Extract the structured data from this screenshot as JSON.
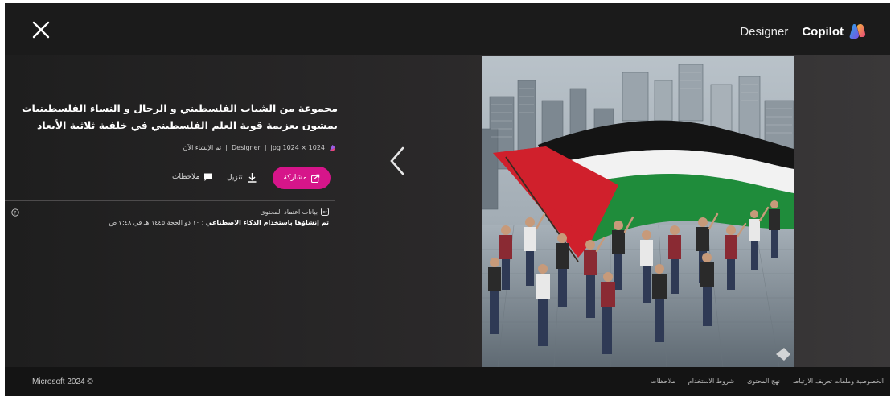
{
  "header": {
    "brand_designer": "Designer",
    "brand_copilot": "Copilot",
    "close_icon": "close-icon",
    "logo_icon": "copilot-logo-icon"
  },
  "details": {
    "title": "مجموعة من الشباب الفلسطيني و الرجال و النساء الفلسطينيات يمشون بعزيمة قوية العلم الفلسطيني في خلفية ثلاثية الأبعاد",
    "meta_source": "Designer",
    "meta_size": "1024 × 1024 jpg",
    "meta_status": "تم الإنشاء الآن",
    "meta_sep": "|",
    "share_label": "مشاركة",
    "download_label": "تنزيل",
    "feedback_label": "ملاحظات",
    "share_color": "#d6158a"
  },
  "credentials": {
    "label": "بيانات اعتماد المحتوى",
    "generated_bold": "تم إنشاؤها باستخدام الذكاء الاصطناعي",
    "generated_rest": ": ١٠ ذو الحجة ١٤٤٥ هـ في ٧:٤٨ ص"
  },
  "footer": {
    "copyright": "Microsoft 2024 ©",
    "links": [
      "الخصوصية وملفات تعريف الارتباط",
      "نهج المحتوى",
      "شروط الاستخدام",
      "ملاحظات"
    ]
  },
  "image": {
    "flag_colors": {
      "black": "#141414",
      "white": "#f2f2f2",
      "green": "#1f8c3b",
      "red": "#d0202c"
    }
  }
}
